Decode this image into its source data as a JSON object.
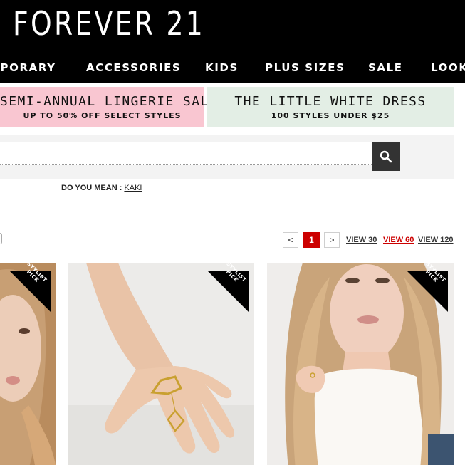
{
  "brand": {
    "logo": "FOREVER 21"
  },
  "nav": {
    "items": [
      {
        "label": "MPORARY"
      },
      {
        "label": "ACCESSORIES"
      },
      {
        "label": "KIDS"
      },
      {
        "label": "PLUS SIZES"
      },
      {
        "label": "SALE"
      },
      {
        "label": "LOOK"
      }
    ]
  },
  "promos": [
    {
      "title": "SEMI-ANNUAL LINGERIE SALE",
      "subtitle": "UP TO 50% OFF SELECT STYLES",
      "color": "#f9c6d1"
    },
    {
      "title": "THE LITTLE WHITE DRESS",
      "subtitle": "100 STYLES UNDER $25",
      "color": "#e3eee5"
    }
  ],
  "search": {
    "value": "",
    "placeholder": "",
    "button_icon": "search-icon"
  },
  "suggestion": {
    "label": "DO YOU MEAN :",
    "term": "KAKI"
  },
  "pagination": {
    "prev": "<",
    "current": "1",
    "next": ">",
    "view_options": [
      {
        "label": "VIEW 30",
        "active": false
      },
      {
        "label": "VIEW 60",
        "active": true
      },
      {
        "label": "VIEW 120",
        "active": false
      }
    ]
  },
  "products": [
    {
      "badge": "STYLIST PICK",
      "image": "model-portrait-partial"
    },
    {
      "badge": "STYLIST PICK",
      "image": "hand-with-gold-ring"
    },
    {
      "badge": "STYLIST PICK",
      "image": "blonde-model-with-ring"
    }
  ],
  "colors": {
    "accent": "#cc0000",
    "header_bg": "#000000",
    "search_btn": "#333333"
  }
}
